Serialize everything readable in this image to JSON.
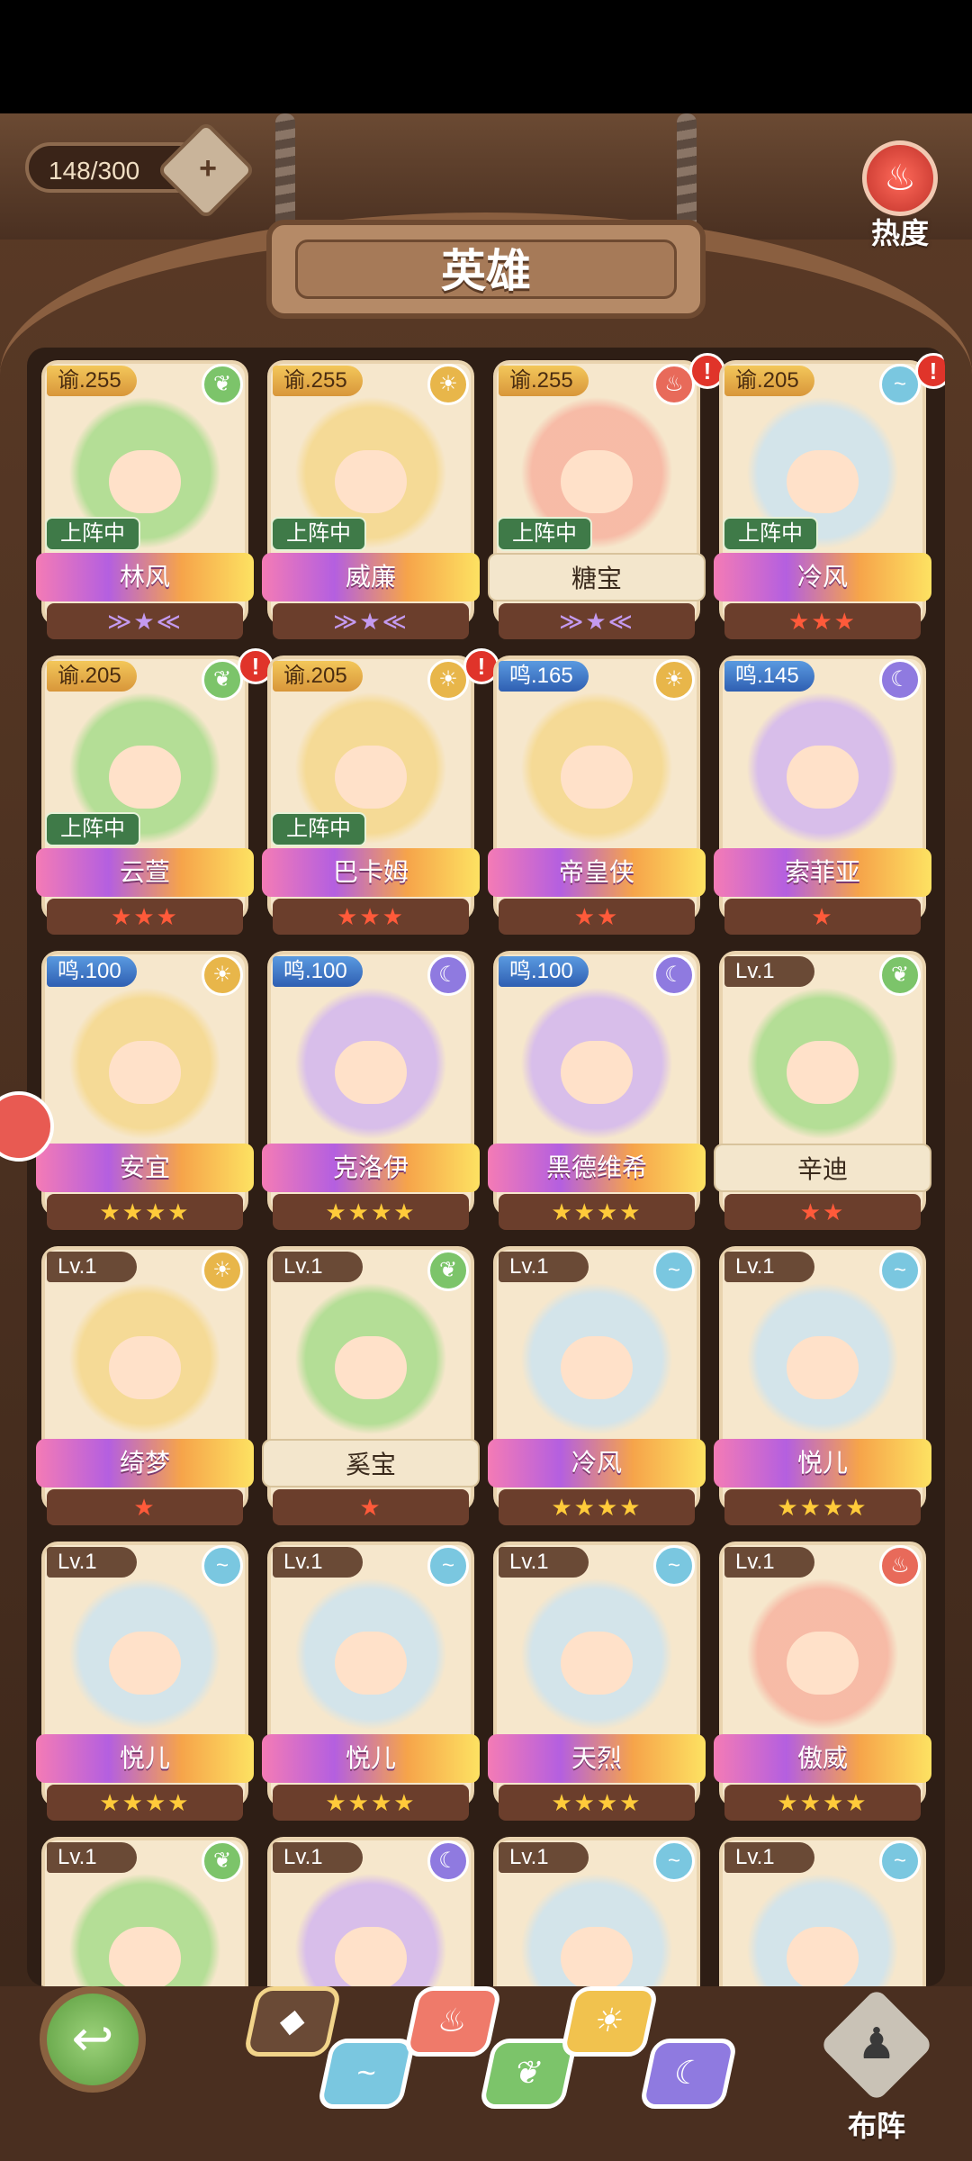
{
  "header": {
    "counter": "148/300",
    "add_symbol": "+",
    "title": "英雄",
    "heat_label": "热度",
    "heat_icon": "flame-icon"
  },
  "colors": {
    "fire": "#e86a5a",
    "light": "#e8b64a",
    "nature": "#7cc46a",
    "wind": "#7ac7e0",
    "moon": "#8f7ae0",
    "deployed": "#3f7a48"
  },
  "heroes": [
    {
      "name": "林风",
      "level": "谕.255",
      "element": "nature",
      "deployed": "上阵中",
      "stars": "wing"
    },
    {
      "name": "威廉",
      "level": "谕.255",
      "element": "light",
      "deployed": "上阵中",
      "stars": "wing"
    },
    {
      "name": "糖宝",
      "level": "谕.255",
      "element": "fire",
      "deployed": "上阵中",
      "stars": "wing",
      "alert": "!"
    },
    {
      "name": "冷风",
      "level": "谕.205",
      "element": "wind",
      "deployed": "上阵中",
      "stars": "★★★",
      "alert": "!"
    },
    {
      "name": "云萱",
      "level": "谕.205",
      "element": "nature",
      "deployed": "上阵中",
      "stars": "★★★",
      "alert": "!"
    },
    {
      "name": "巴卡姆",
      "level": "谕.205",
      "element": "light",
      "deployed": "上阵中",
      "stars": "★★★",
      "alert": "!"
    },
    {
      "name": "帝皇侠",
      "level": "鸣.165",
      "element": "light",
      "stars": "★★"
    },
    {
      "name": "索菲亚",
      "level": "鸣.145",
      "element": "moon",
      "stars": "★"
    },
    {
      "name": "安宜",
      "level": "鸣.100",
      "element": "light",
      "stars": "★★★★"
    },
    {
      "name": "克洛伊",
      "level": "鸣.100",
      "element": "moon",
      "stars": "★★★★"
    },
    {
      "name": "黑德维希",
      "level": "鸣.100",
      "element": "moon",
      "stars": "★★★★"
    },
    {
      "name": "辛迪",
      "level": "Lv.1",
      "element": "nature",
      "stars": "★★"
    },
    {
      "name": "绮梦",
      "level": "Lv.1",
      "element": "light",
      "stars": "★"
    },
    {
      "name": "奚宝",
      "level": "Lv.1",
      "element": "nature",
      "stars": "★"
    },
    {
      "name": "冷风",
      "level": "Lv.1",
      "element": "wind",
      "stars": "★★★★"
    },
    {
      "name": "悦儿",
      "level": "Lv.1",
      "element": "wind",
      "stars": "★★★★"
    },
    {
      "name": "悦儿",
      "level": "Lv.1",
      "element": "wind",
      "stars": "★★★★"
    },
    {
      "name": "悦儿",
      "level": "Lv.1",
      "element": "wind",
      "stars": "★★★★"
    },
    {
      "name": "天烈",
      "level": "Lv.1",
      "element": "wind",
      "stars": "★★★★"
    },
    {
      "name": "傲威",
      "level": "Lv.1",
      "element": "fire",
      "stars": "★★★★"
    },
    {
      "name": "",
      "level": "Lv.1",
      "element": "nature",
      "stars": ""
    },
    {
      "name": "",
      "level": "Lv.1",
      "element": "moon",
      "stars": ""
    },
    {
      "name": "",
      "level": "Lv.1",
      "element": "wind",
      "stars": ""
    },
    {
      "name": "",
      "level": "Lv.1",
      "element": "wind",
      "stars": ""
    }
  ],
  "footer": {
    "back_icon": "back-arrow-icon",
    "formation_label": "布阵",
    "filters": [
      "all",
      "wind",
      "fire",
      "nature",
      "light",
      "moon"
    ]
  }
}
